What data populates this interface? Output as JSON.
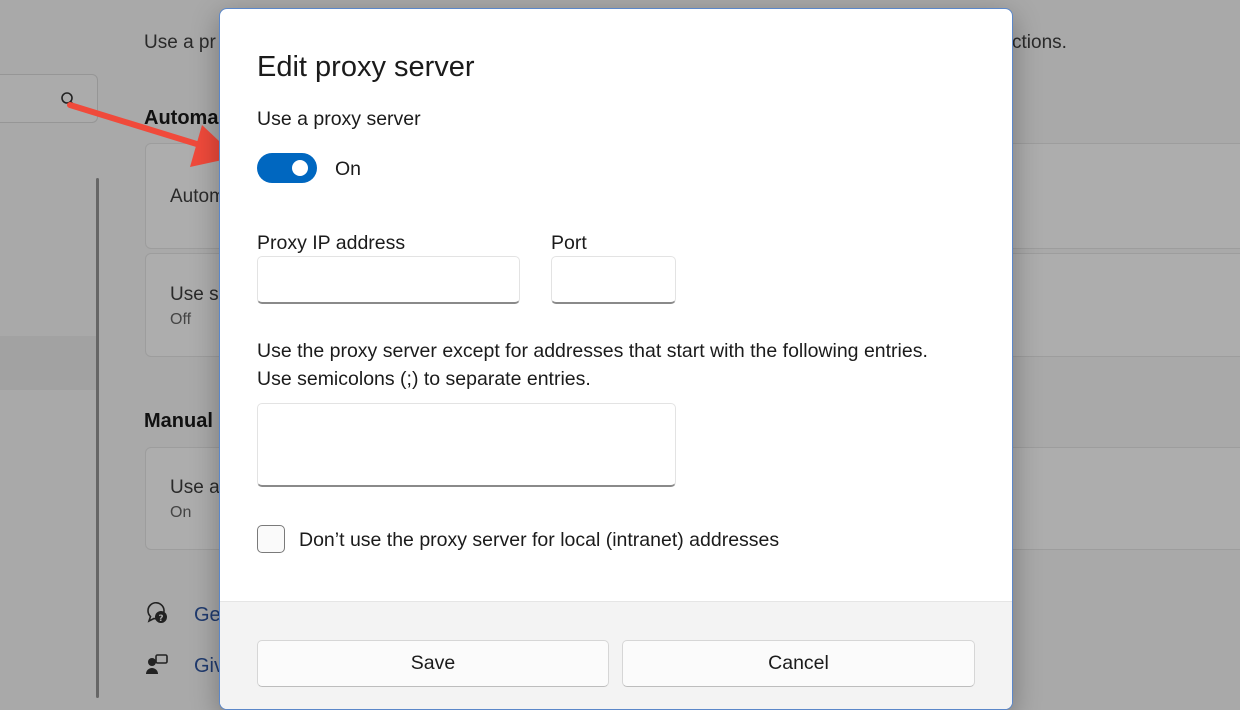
{
  "background": {
    "description_text": "Use a pr",
    "description_tail": "ctions.",
    "automatic_heading": "Automa",
    "cards": [
      {
        "title": "Autom",
        "status": ""
      },
      {
        "title": "Use s",
        "status": "Off"
      },
      {
        "title": "Use a",
        "status": "On"
      }
    ],
    "manual_heading": "Manual",
    "links": [
      "Ge",
      "Giv"
    ],
    "icons": {
      "search": "search-icon",
      "help": "help-icon",
      "feedback": "feedback-icon"
    }
  },
  "annotation": {
    "color": "#f04a3b"
  },
  "dialog": {
    "title": "Edit proxy server",
    "use_proxy_label": "Use a proxy server",
    "toggle_state": "On",
    "ip_label": "Proxy IP address",
    "ip_value": "",
    "port_label": "Port",
    "port_value": "",
    "exceptions_label_line1": "Use the proxy server except for addresses that start with the following entries.",
    "exceptions_label_line2": "Use semicolons (;) to separate entries.",
    "exceptions_value": "",
    "local_checkbox_label": "Don’t use the proxy server for local (intranet) addresses",
    "local_checkbox_checked": false,
    "save_label": "Save",
    "cancel_label": "Cancel"
  },
  "colors": {
    "accent": "#0067c0",
    "dialog_border": "#5b87c9"
  }
}
